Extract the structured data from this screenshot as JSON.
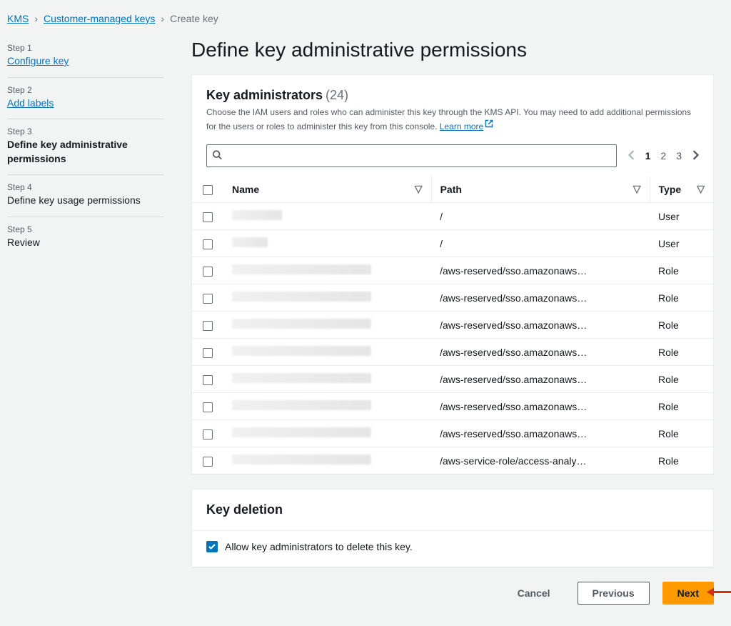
{
  "breadcrumb": {
    "items": [
      {
        "label": "KMS",
        "link": true
      },
      {
        "label": "Customer-managed keys",
        "link": true
      },
      {
        "label": "Create key",
        "link": false
      }
    ]
  },
  "sidebar": {
    "steps": [
      {
        "num": "Step 1",
        "label": "Configure key",
        "link": true,
        "active": false
      },
      {
        "num": "Step 2",
        "label": "Add labels",
        "link": true,
        "active": false
      },
      {
        "num": "Step 3",
        "label": "Define key administrative permissions",
        "link": false,
        "active": true
      },
      {
        "num": "Step 4",
        "label": "Define key usage permissions",
        "link": false,
        "active": false
      },
      {
        "num": "Step 5",
        "label": "Review",
        "link": false,
        "active": false
      }
    ]
  },
  "page_title": "Define key administrative permissions",
  "admins": {
    "title": "Key administrators",
    "count": "(24)",
    "desc_pre": "Choose the IAM users and roles who can administer this key through the KMS API. You may need to add additional permissions for the users or roles to administer this key from this console. ",
    "learn_more": "Learn more",
    "search_placeholder": "",
    "pager": {
      "pages": [
        "1",
        "2",
        "3"
      ],
      "current": "1"
    },
    "columns": {
      "name": "Name",
      "path": "Path",
      "type": "Type"
    },
    "rows": [
      {
        "name_redact_w": 70,
        "path": "/",
        "type": "User"
      },
      {
        "name_redact_w": 50,
        "path": "/",
        "type": "User"
      },
      {
        "name_redact_w": 195,
        "path": "/aws-reserved/sso.amazonaws…",
        "type": "Role"
      },
      {
        "name_redact_w": 195,
        "path": "/aws-reserved/sso.amazonaws…",
        "type": "Role"
      },
      {
        "name_redact_w": 195,
        "path": "/aws-reserved/sso.amazonaws…",
        "type": "Role"
      },
      {
        "name_redact_w": 195,
        "path": "/aws-reserved/sso.amazonaws…",
        "type": "Role"
      },
      {
        "name_redact_w": 195,
        "path": "/aws-reserved/sso.amazonaws…",
        "type": "Role"
      },
      {
        "name_redact_w": 195,
        "path": "/aws-reserved/sso.amazonaws…",
        "type": "Role"
      },
      {
        "name_redact_w": 195,
        "path": "/aws-reserved/sso.amazonaws…",
        "type": "Role"
      },
      {
        "name_redact_w": 195,
        "path": "/aws-service-role/access-analy…",
        "type": "Role"
      }
    ]
  },
  "deletion": {
    "title": "Key deletion",
    "checkbox_label": "Allow key administrators to delete this key.",
    "checked": true
  },
  "footer": {
    "cancel": "Cancel",
    "previous": "Previous",
    "next": "Next"
  }
}
